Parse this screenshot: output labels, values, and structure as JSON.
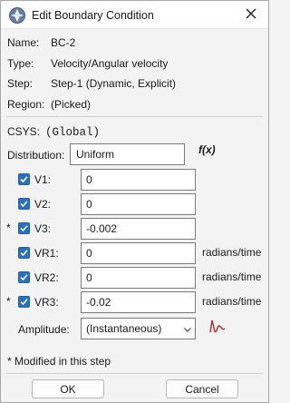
{
  "window": {
    "title": "Edit Boundary Condition",
    "icon": "abaqus-app-icon"
  },
  "info": {
    "name_label": "Name:",
    "name_value": "BC-2",
    "type_label": "Type:",
    "type_value": "Velocity/Angular velocity",
    "step_label": "Step:",
    "step_value": "Step-1 (Dynamic, Explicit)",
    "region_label": "Region:",
    "region_value": "(Picked)"
  },
  "csys": {
    "label": "CSYS:",
    "value": "(Global)"
  },
  "distribution": {
    "label": "Distribution:",
    "value": "Uniform",
    "fx_label": "f(x)"
  },
  "rows": [
    {
      "mark": "",
      "label": "V1:",
      "checked": true,
      "value": "0",
      "unit": ""
    },
    {
      "mark": "",
      "label": "V2:",
      "checked": true,
      "value": "0",
      "unit": ""
    },
    {
      "mark": "*",
      "label": "V3:",
      "checked": true,
      "value": "-0.002",
      "unit": ""
    },
    {
      "mark": "",
      "label": "VR1:",
      "checked": true,
      "value": "0",
      "unit": "radians/time"
    },
    {
      "mark": "",
      "label": "VR2:",
      "checked": true,
      "value": "0",
      "unit": "radians/time"
    },
    {
      "mark": "*",
      "label": "VR3:",
      "checked": true,
      "value": "-0.02",
      "unit": "radians/time"
    }
  ],
  "amplitude": {
    "label": "Amplitude:",
    "value": "(Instantaneous)",
    "icon": "amplitude-graph-icon"
  },
  "footnote": "* Modified in this step",
  "buttons": {
    "ok": "OK",
    "cancel": "Cancel"
  },
  "colors": {
    "checkbox": "#2f6fb3",
    "amplitude_icon": "#b3262a",
    "window_bg": "#f3f3f3"
  }
}
